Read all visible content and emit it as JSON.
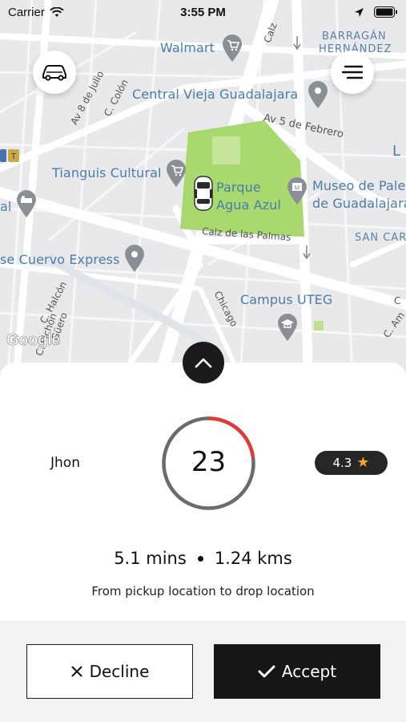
{
  "status_bar": {
    "carrier": "Carrier",
    "time": "3:55 PM"
  },
  "map": {
    "places": [
      {
        "id": "walmart",
        "label": "Walmart"
      },
      {
        "id": "central-vieja",
        "label": "Central Vieja Guadalajara"
      },
      {
        "id": "tianguis",
        "label": "Tianguis Cultural"
      },
      {
        "id": "parque-1",
        "label": "Parque"
      },
      {
        "id": "parque-2",
        "label": "Agua Azul"
      },
      {
        "id": "museo-1",
        "label": "Museo de Pale"
      },
      {
        "id": "museo-2",
        "label": "de Guadalajara"
      },
      {
        "id": "cuervo",
        "label": "se Cuervo Express"
      },
      {
        "id": "campus",
        "label": "Campus UTEG"
      },
      {
        "id": "al",
        "label": "al"
      },
      {
        "id": "l-edge",
        "label": "L"
      }
    ],
    "districts": [
      {
        "id": "barragan-1",
        "label": "BARRAGÁN"
      },
      {
        "id": "barragan-2",
        "label": "HERNÁNDEZ"
      },
      {
        "id": "san-carlos",
        "label": "SAN CAR"
      }
    ],
    "streets": {
      "av5feb": "Av 5 de Febrero",
      "calz_palmas": "Calz de las Palmas",
      "av8julio": "Av 8 de Julio",
      "ccolon": "C. Colón",
      "chalcon": "C. Halcón",
      "pichon": "C. Pichón",
      "guero": "Güero",
      "chicago": "Chicago",
      "calz_top": "Calz",
      "c_edge": "C",
      "c_am": "C. Am"
    },
    "attribution": "Google"
  },
  "trip_request": {
    "rider_name": "Jhon",
    "countdown": "23",
    "countdown_fraction": 0.23,
    "rating": "4.3",
    "rating_icon": "star-icon",
    "duration": "5.1 mins",
    "distance": "1.24 kms",
    "route_note": "From pickup location to drop location"
  },
  "actions": {
    "decline_label": "Decline",
    "accept_label": "Accept"
  },
  "colors": {
    "accent_red": "#e53935",
    "ring_gray": "#6b6b6b",
    "star": "#f5a623",
    "park_green": "#a9d86e",
    "map_label_blue": "#4a7da8"
  }
}
